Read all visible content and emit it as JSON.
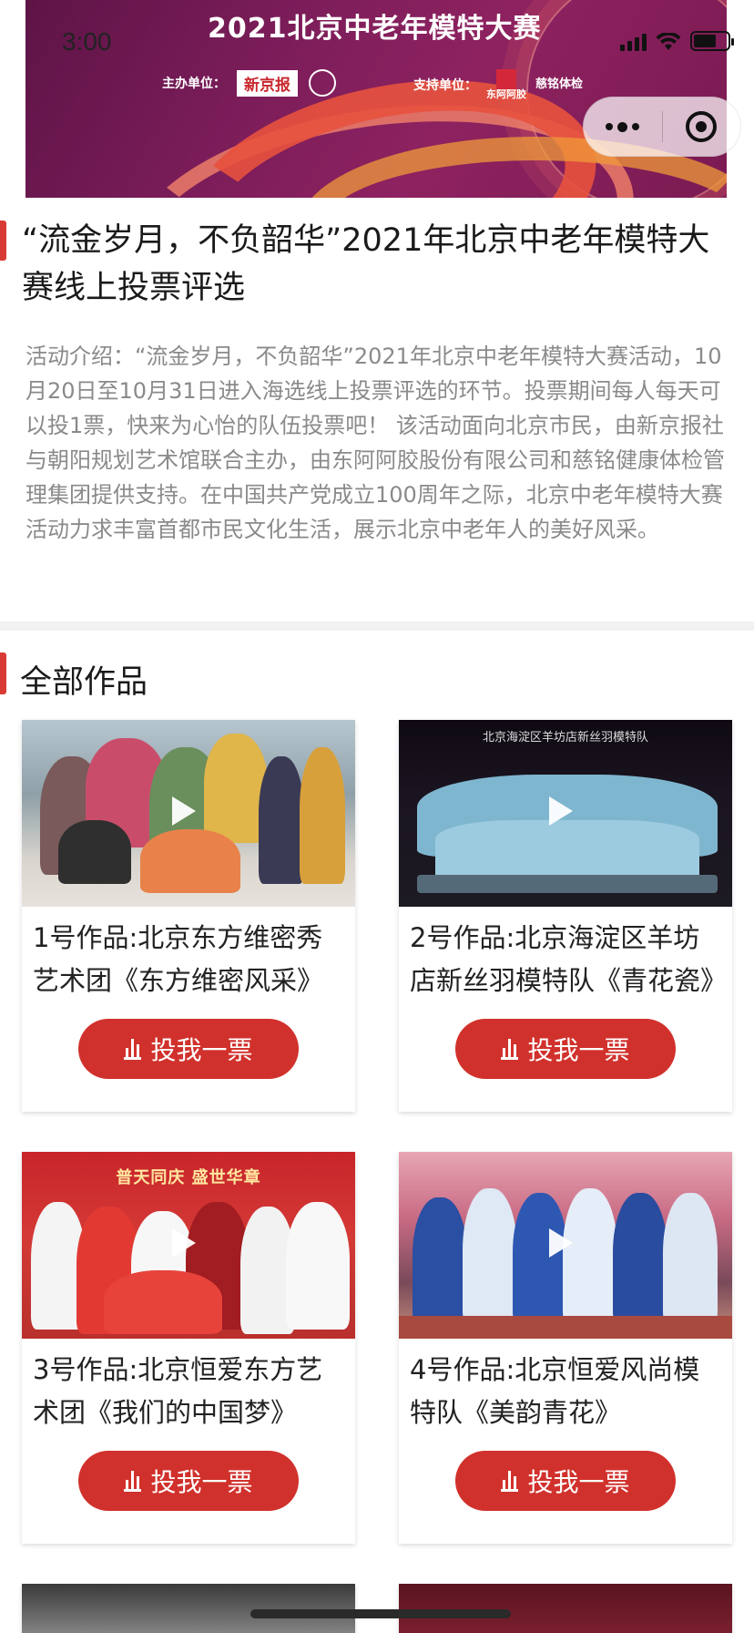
{
  "status_bar": {
    "time": "3:00"
  },
  "banner": {
    "title": "2021北京中老年模特大赛",
    "organizer_label": "主办单位：",
    "organizer_name": "新京报",
    "supporter_label": "支持单位：",
    "supporter_1": "东阿阿胶",
    "supporter_2": "慈铭体检"
  },
  "capsule": {
    "more_icon": "more-dots-icon",
    "close_icon": "close-target-icon"
  },
  "article": {
    "title": "“流金岁月，不负韶华”2021年北京中老年模特大赛线上投票评选",
    "description": "活动介绍：“流金岁月，不负韶华”2021年北京中老年模特大赛活动，10月20日至10月31日进入海选线上投票评选的环节。投票期间每人每天可以投1票，快来为心怡的队伍投票吧！ 该活动面向北京市民，由新京报社与朝阳规划艺术馆联合主办，由东阿阿胶股份有限公司和慈铭健康体检管理集团提供支持。在中国共产党成立100周年之际，北京中老年模特大赛活动力求丰富首都市民文化生活，展示北京中老年人的美好风采。"
  },
  "section": {
    "title": "全部作品"
  },
  "works": [
    {
      "title": "1号作品:北京东方维密秀艺术团《东方维密风采》",
      "vote_label": "投我一票",
      "thumb_caption": ""
    },
    {
      "title": "2号作品:北京海淀区羊坊店新丝羽模特队《青花瓷》",
      "vote_label": "投我一票",
      "thumb_caption": "北京海淀区羊坊店新丝羽模特队"
    },
    {
      "title": "3号作品:北京恒爱东方艺术团《我们的中国梦》",
      "vote_label": "投我一票",
      "thumb_caption": "普天同庆 盛世华章"
    },
    {
      "title": "4号作品:北京恒爱风尚模特队《美韵青花》",
      "vote_label": "投我一票",
      "thumb_caption": ""
    }
  ],
  "colors": {
    "accent": "#d1312c",
    "text_muted": "#8a8a8a"
  }
}
